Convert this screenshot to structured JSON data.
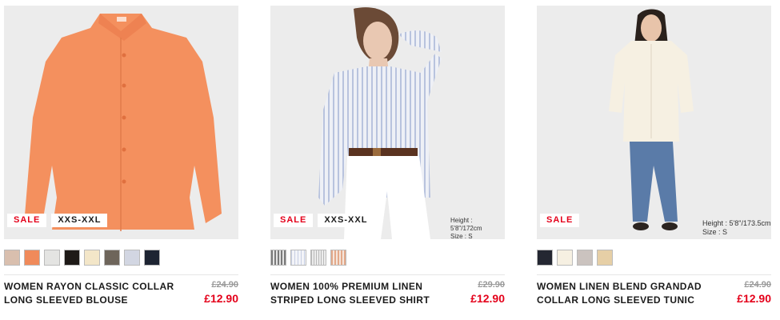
{
  "products": [
    {
      "name": "WOMEN RAYON CLASSIC COLLAR LONG SLEEVED BLOUSE",
      "badge_sale": "SALE",
      "badge_size": "XXS-XXL",
      "model_height": "",
      "model_size": "",
      "original_price": "£24.90",
      "sale_price": "£12.90",
      "image_icon": "orange-blouse-photo",
      "swatches": [
        "#d9bfae",
        "#f08a5a",
        "#e4e4e2",
        "#1e1a17",
        "#f3e6c8",
        "#6e655b",
        "#d2d6e2",
        "#1d2432"
      ]
    },
    {
      "name": "WOMEN 100% PREMIUM LINEN STRIPED LONG SLEEVED SHIRT",
      "badge_sale": "SALE",
      "badge_size": "XXS-XXL",
      "model_height": "Height : 5'8\"/172cm",
      "model_size": "Size : S",
      "original_price": "£29.90",
      "sale_price": "£12.90",
      "image_icon": "model-striped-shirt-photo",
      "swatches": [
        "stripe-gray",
        "stripe-blue",
        "stripe-lightgray",
        "stripe-peach"
      ]
    },
    {
      "name": "WOMEN LINEN BLEND GRANDAD COLLAR LONG SLEEVED TUNIC",
      "badge_sale": "SALE",
      "badge_size": "",
      "model_height": "Height : 5'8\"/173.5cm",
      "model_size": "Size : S",
      "original_price": "£24.90",
      "sale_price": "£12.90",
      "image_icon": "model-tunic-photo",
      "swatches": [
        "#242732",
        "#f6f0e2",
        "#cbc3bf",
        "#e6cfa6"
      ]
    }
  ]
}
